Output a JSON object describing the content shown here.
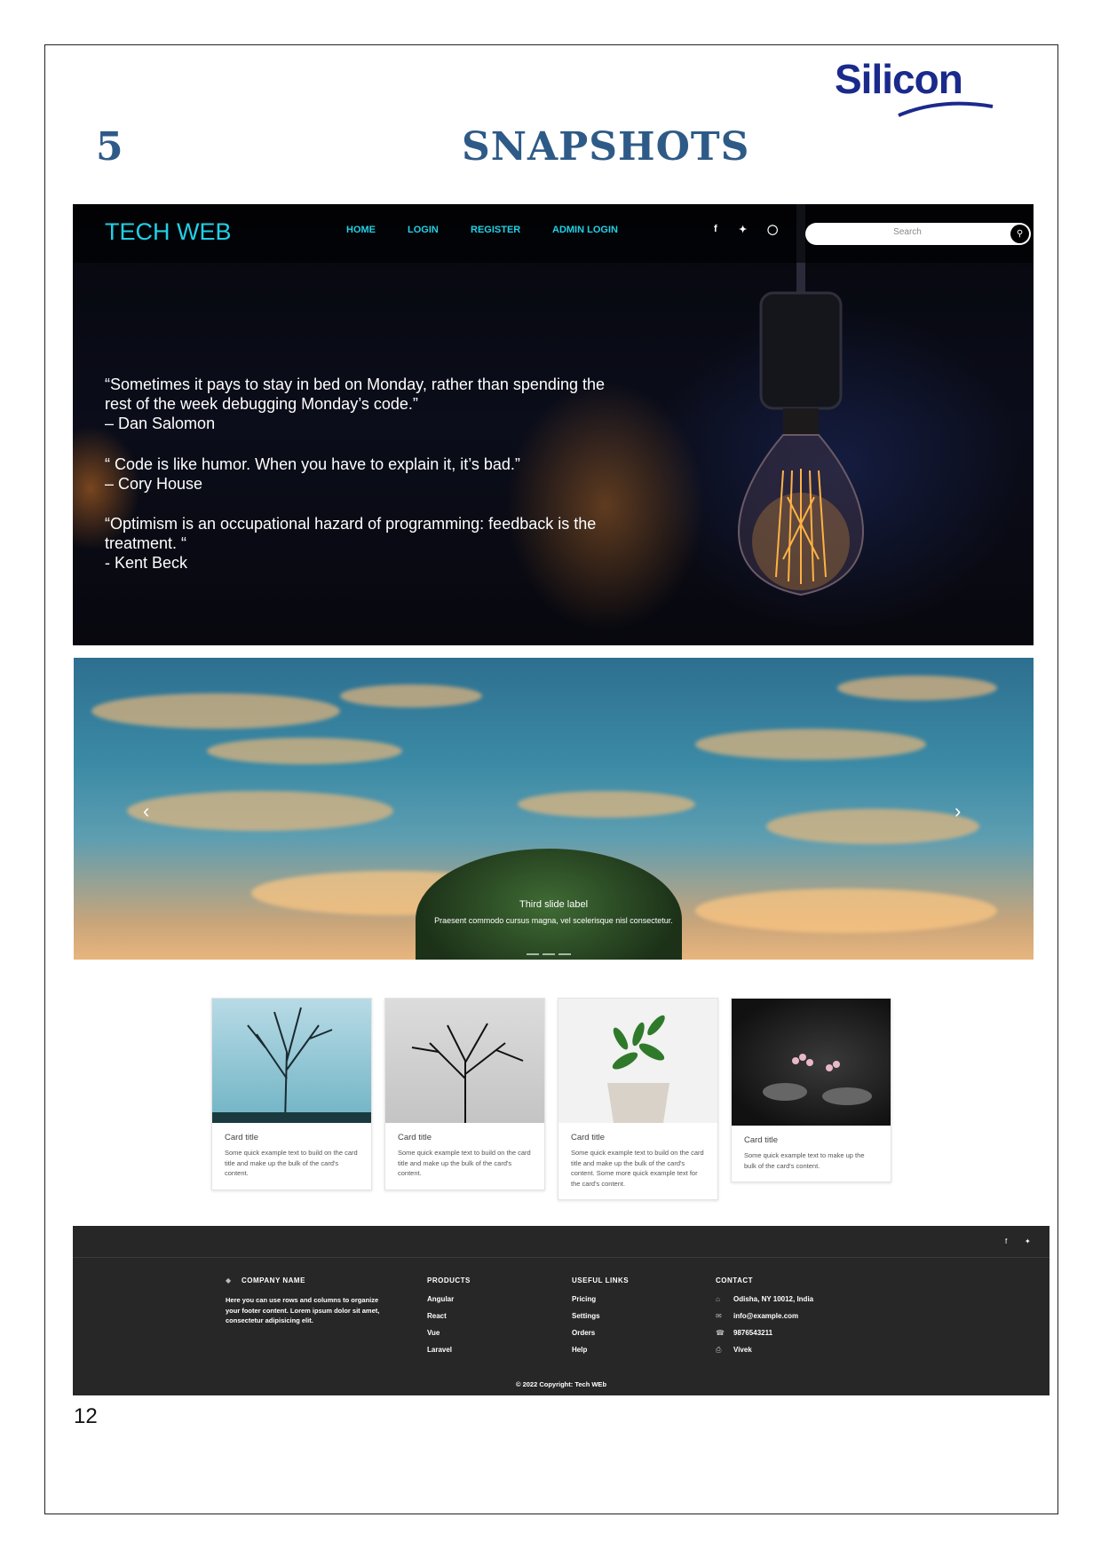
{
  "document": {
    "logo_text": "Silicon",
    "chapter_number": "5",
    "chapter_title": "SNAPSHOTS",
    "page_number": "12"
  },
  "site": {
    "brand": "TECH WEB",
    "nav": [
      "HOME",
      "LOGIN",
      "REGISTER",
      "ADMIN LOGIN"
    ],
    "social_icons": [
      "facebook-icon",
      "twitter-icon",
      "instagram-icon"
    ],
    "search_placeholder": "Search",
    "quotes": [
      {
        "line1": "“Sometimes it pays to stay in bed on Monday, rather than spending the",
        "line2": "rest of the week debugging Monday’s code.”",
        "author": "– Dan Salomon"
      },
      {
        "line1": "“ Code is like humor. When you have to explain it, it’s bad.”",
        "line2": "",
        "author": "– Cory House"
      },
      {
        "line1": "“Optimism is an occupational hazard of programming: feedback is the",
        "line2": "treatment. “",
        "author": "- Kent Beck"
      }
    ],
    "carousel": {
      "label": "Third slide label",
      "caption": "Praesent commodo cursus magna, vel scelerisque nisl consectetur."
    },
    "cards": [
      {
        "title": "Card title",
        "text": "Some quick example text to build on the card title and make up the bulk of the card's content."
      },
      {
        "title": "Card title",
        "text": "Some quick example text to build on the card title and make up the bulk of the card's content."
      },
      {
        "title": "Card title",
        "text": "Some quick example text to build on the card title and make up the bulk of the card's content. Some more quick example text for the card's content."
      },
      {
        "title": "Card title",
        "text": "Some quick example text to make up the bulk of the card's content."
      }
    ],
    "footer": {
      "company_heading": "COMPANY NAME",
      "company_text": "Here you can use rows and columns to organize your footer content. Lorem ipsum dolor sit amet, consectetur adipisicing elit.",
      "products_heading": "PRODUCTS",
      "products": [
        "Angular",
        "React",
        "Vue",
        "Laravel"
      ],
      "links_heading": "USEFUL LINKS",
      "links": [
        "Pricing",
        "Settings",
        "Orders",
        "Help"
      ],
      "contact_heading": "CONTACT",
      "contact": [
        "Odisha, NY 10012, India",
        "info@example.com",
        "9876543211",
        "Vivek"
      ],
      "copyright": "© 2022 Copyright: Tech WEb"
    }
  }
}
